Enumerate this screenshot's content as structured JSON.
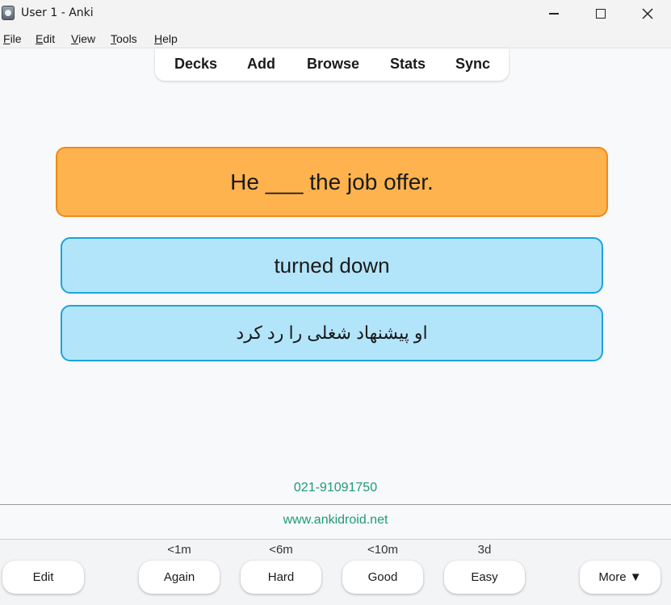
{
  "window": {
    "title": "User 1 - Anki"
  },
  "menubar": {
    "items": [
      {
        "accel": "F",
        "rest": "ile"
      },
      {
        "accel": "E",
        "rest": "dit"
      },
      {
        "accel": "V",
        "rest": "iew"
      },
      {
        "accel": "T",
        "rest": "ools"
      },
      {
        "accel": "H",
        "rest": "elp"
      }
    ]
  },
  "toolbar": {
    "decks": "Decks",
    "add": "Add",
    "browse": "Browse",
    "stats": "Stats",
    "sync": "Sync"
  },
  "card": {
    "front": "He ___ the job offer.",
    "answer": "turned down",
    "translation": "او پیشنهاد شغلی را رد کرد"
  },
  "footer": {
    "phone": "021-91091750",
    "website": "www.ankidroid.net"
  },
  "answer_buttons": {
    "edit": "Edit",
    "again": {
      "label": "Again",
      "interval": "<1m"
    },
    "hard": {
      "label": "Hard",
      "interval": "<6m"
    },
    "good": {
      "label": "Good",
      "interval": "<10m"
    },
    "easy": {
      "label": "Easy",
      "interval": "3d"
    },
    "more": "More ▼"
  },
  "colors": {
    "front_bg": "#ffb34f",
    "front_border": "#f08a16",
    "back_bg": "#b3e5fa",
    "back_border": "#1aa4e0",
    "link_green": "#1e9b6e"
  }
}
